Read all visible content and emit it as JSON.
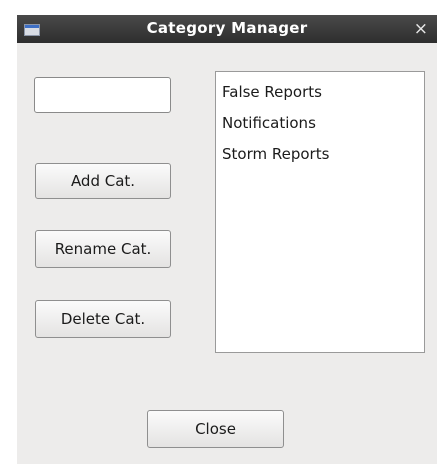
{
  "window": {
    "title": "Category Manager",
    "close_glyph": "×",
    "icon": "window-icon"
  },
  "category_input": {
    "value": "",
    "placeholder": ""
  },
  "buttons": {
    "add_label": "Add Cat.",
    "rename_label": "Rename Cat.",
    "delete_label": "Delete Cat.",
    "close_label": "Close"
  },
  "categories": [
    "False Reports",
    "Notifications",
    "Storm Reports"
  ],
  "colors": {
    "titlebar": "#3a3a3a",
    "window_bg": "#edeceb",
    "list_bg": "#ffffff"
  }
}
